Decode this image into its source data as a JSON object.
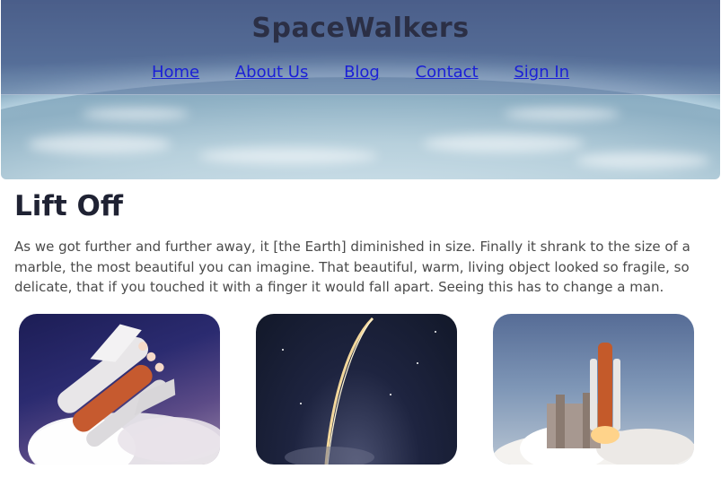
{
  "header": {
    "site_title": "SpaceWalkers",
    "nav": [
      {
        "label": "Home"
      },
      {
        "label": "About Us"
      },
      {
        "label": "Blog"
      },
      {
        "label": "Contact"
      },
      {
        "label": "Sign In"
      }
    ]
  },
  "main": {
    "title": "Lift Off",
    "paragraph": "As we got further and further away, it [the Earth] diminished in size. Finally it shrank to the size of a marble, the most beautiful you can imagine. That beautiful, warm, living object looked so fragile, so delicate, that if you touched it with a finger it would fall apart. Seeing this has to change a man."
  },
  "gallery": {
    "images": [
      {
        "subject": "space-shuttle-in-flight"
      },
      {
        "subject": "rocket-launch-arc-at-night"
      },
      {
        "subject": "shuttle-on-launch-pad"
      }
    ]
  },
  "colors": {
    "link": "#1a1fd6",
    "title": "#2b2f45",
    "text": "#4a4a4a"
  }
}
